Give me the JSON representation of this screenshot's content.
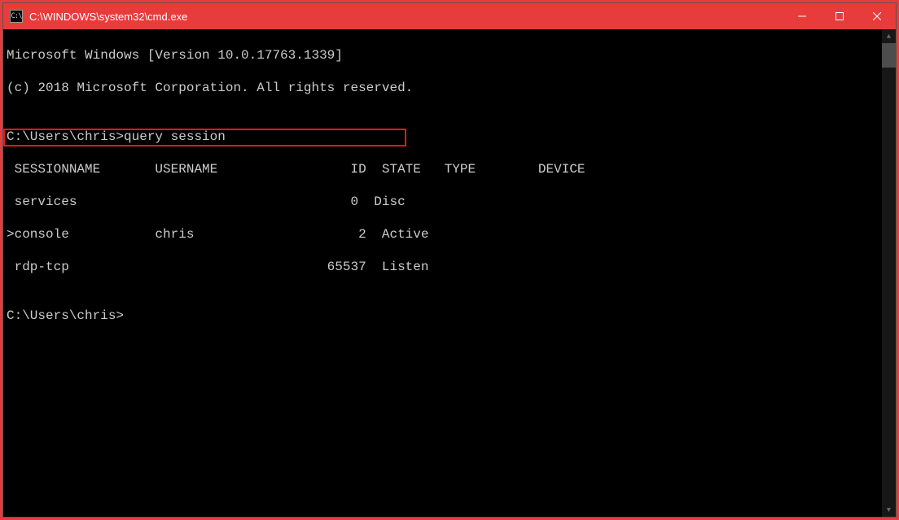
{
  "window": {
    "title": "C:\\WINDOWS\\system32\\cmd.exe"
  },
  "terminal": {
    "line1": "Microsoft Windows [Version 10.0.17763.1339]",
    "line2": "(c) 2018 Microsoft Corporation. All rights reserved.",
    "blank1": "",
    "prompt1": "C:\\Users\\chris>query session",
    "header": " SESSIONNAME       USERNAME                 ID  STATE   TYPE        DEVICE",
    "row1": " services                                   0  Disc",
    "row2": ">console           chris                     2  Active",
    "row3": " rdp-tcp                                 65537  Listen",
    "blank2": "",
    "prompt2": "C:\\Users\\chris>"
  },
  "table_data": {
    "columns": [
      "SESSIONNAME",
      "USERNAME",
      "ID",
      "STATE",
      "TYPE",
      "DEVICE"
    ],
    "rows": [
      {
        "sessionname": "services",
        "username": "",
        "id": 0,
        "state": "Disc",
        "type": "",
        "device": ""
      },
      {
        "sessionname": "console",
        "username": "chris",
        "id": 2,
        "state": "Active",
        "type": "",
        "device": "",
        "current": true
      },
      {
        "sessionname": "rdp-tcp",
        "username": "",
        "id": 65537,
        "state": "Listen",
        "type": "",
        "device": ""
      }
    ]
  }
}
